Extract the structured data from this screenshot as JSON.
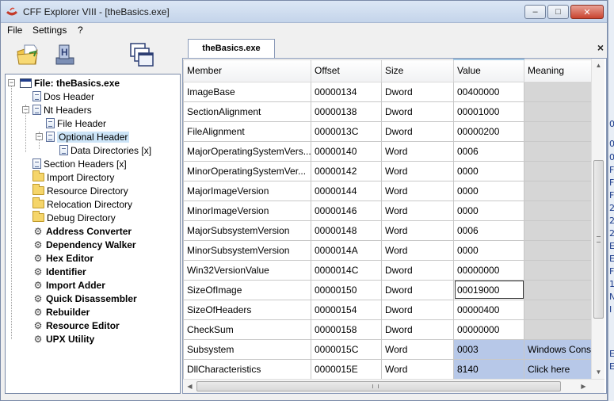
{
  "window": {
    "title": "CFF Explorer VIII - [theBasics.exe]"
  },
  "window_controls": {
    "minimize": "–",
    "maximize": "□",
    "close": "✕"
  },
  "menu": [
    "File",
    "Settings",
    "?"
  ],
  "toolbar": {
    "icons": [
      "open-file-icon",
      "save-icon",
      "windows-icon"
    ]
  },
  "tree": {
    "expanders": {
      "collapse": "−"
    },
    "root": "File: theBasics.exe",
    "dos_header": "Dos Header",
    "nt_headers": "Nt Headers",
    "file_header": "File Header",
    "optional_header": "Optional Header",
    "data_directories": "Data Directories [x]",
    "section_headers": "Section Headers [x]",
    "import_directory": "Import Directory",
    "resource_directory": "Resource Directory",
    "relocation_directory": "Relocation Directory",
    "debug_directory": "Debug Directory",
    "address_converter": "Address Converter",
    "dependency_walker": "Dependency Walker",
    "hex_editor": "Hex Editor",
    "identifier": "Identifier",
    "import_adder": "Import Adder",
    "quick_disassembler": "Quick Disassembler",
    "rebuilder": "Rebuilder",
    "resource_editor": "Resource Editor",
    "upx_utility": "UPX Utility"
  },
  "tab": {
    "label": "theBasics.exe",
    "close": "×"
  },
  "grid": {
    "columns": [
      "Member",
      "Offset",
      "Size",
      "Value",
      "Meaning"
    ],
    "rows": [
      [
        "ImageBase",
        "00000134",
        "Dword",
        "00400000",
        ""
      ],
      [
        "SectionAlignment",
        "00000138",
        "Dword",
        "00001000",
        ""
      ],
      [
        "FileAlignment",
        "0000013C",
        "Dword",
        "00000200",
        ""
      ],
      [
        "MajorOperatingSystemVers...",
        "00000140",
        "Word",
        "0006",
        ""
      ],
      [
        "MinorOperatingSystemVer...",
        "00000142",
        "Word",
        "0000",
        ""
      ],
      [
        "MajorImageVersion",
        "00000144",
        "Word",
        "0000",
        ""
      ],
      [
        "MinorImageVersion",
        "00000146",
        "Word",
        "0000",
        ""
      ],
      [
        "MajorSubsystemVersion",
        "00000148",
        "Word",
        "0006",
        ""
      ],
      [
        "MinorSubsystemVersion",
        "0000014A",
        "Word",
        "0000",
        ""
      ],
      [
        "Win32VersionValue",
        "0000014C",
        "Dword",
        "00000000",
        ""
      ],
      [
        "SizeOfImage",
        "00000150",
        "Dword",
        "00019000",
        ""
      ],
      [
        "SizeOfHeaders",
        "00000154",
        "Dword",
        "00000400",
        ""
      ],
      [
        "CheckSum",
        "00000158",
        "Dword",
        "00000000",
        ""
      ],
      [
        "Subsystem",
        "0000015C",
        "Word",
        "0003",
        "Windows Cons"
      ],
      [
        "DllCharacteristics",
        "0000015E",
        "Word",
        "8140",
        "Click here"
      ]
    ]
  },
  "scrollbars": {
    "up": "▲",
    "down": "▼",
    "left": "◀",
    "right": "▶"
  },
  "side_strip": [
    "0",
    "0",
    "0",
    "F",
    "F",
    "F",
    "2",
    "2",
    "2",
    "E",
    "E",
    "F",
    "1",
    "N",
    "I",
    "E",
    "E"
  ]
}
